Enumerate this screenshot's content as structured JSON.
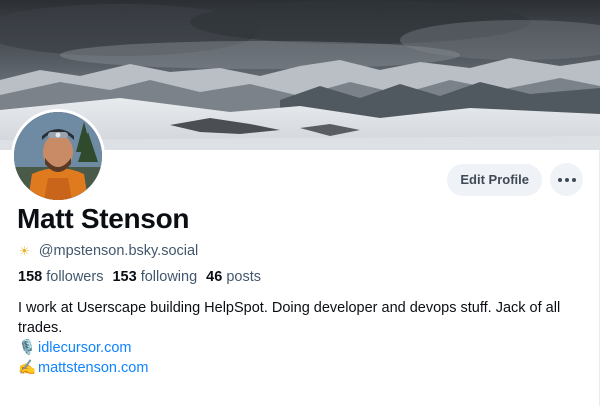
{
  "profile": {
    "display_name": "Matt Stenson",
    "handle_icon": "sunrise-icon",
    "handle_icon_glyph": "☀",
    "handle": "@mpstenson.bsky.social",
    "stats": {
      "followers_count": "158",
      "followers_label": "followers",
      "following_count": "153",
      "following_label": "following",
      "posts_count": "46",
      "posts_label": "posts"
    },
    "bio": {
      "text": "I work at Userscape building HelpSpot. Doing developer and devops stuff. Jack of all trades.",
      "links": [
        {
          "icon": "microphone-icon",
          "emoji": "🎙️",
          "label": "idlecursor.com"
        },
        {
          "icon": "writing-hand-icon",
          "emoji": "✍️",
          "label": "mattstenson.com"
        }
      ]
    }
  },
  "actions": {
    "edit_profile_label": "Edit Profile",
    "more_icon": "more-horizontal-icon"
  },
  "colors": {
    "accent_link": "#1083fe",
    "muted_text": "#42576c",
    "button_bg": "#eff2f6"
  }
}
